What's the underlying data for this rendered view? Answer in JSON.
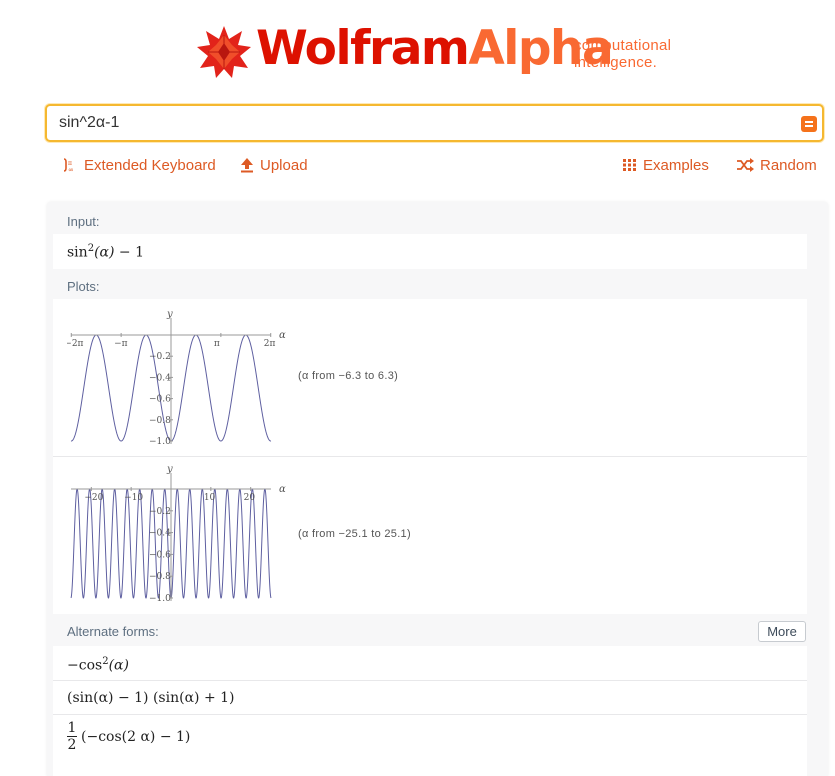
{
  "header": {
    "logo_wolfram": "Wolfram",
    "logo_alpha": "Alpha",
    "tagline_line1": "computational",
    "tagline_line2": "intelligence.",
    "logo_icon": "wolfram-star-icon"
  },
  "search": {
    "value": "sin^2α-1",
    "submit_icon": "equals-icon"
  },
  "toolbar": {
    "extended_keyboard": "Extended Keyboard",
    "upload": "Upload",
    "examples": "Examples",
    "random": "Random"
  },
  "pods": {
    "input": {
      "title": "Input:",
      "fn": "sin",
      "exp": "2",
      "arg": "(α)",
      "rest": " − 1"
    },
    "plots": {
      "title": "Plots:",
      "plot1": {
        "y_label": "y",
        "x_label": "α",
        "x_ticks": [
          "−2π",
          "−π",
          "π",
          "2π"
        ],
        "y_ticks": [
          "−0.2",
          "−0.4",
          "−0.6",
          "−0.8",
          "−1.0"
        ],
        "range_note": "(α from −6.3 to 6.3)"
      },
      "plot2": {
        "y_label": "y",
        "x_label": "α",
        "x_ticks": [
          "−20",
          "−10",
          "10",
          "20"
        ],
        "y_ticks": [
          "−0.2",
          "−0.4",
          "−0.6",
          "−0.8",
          "−1.0"
        ],
        "range_note": "(α from −25.1 to 25.1)"
      }
    },
    "alternate": {
      "title": "Alternate forms:",
      "more": "More",
      "form1_sign": "−",
      "form1_fn": "cos",
      "form1_exp": "2",
      "form1_arg": "(α)",
      "form2": "(sin(α) − 1) (sin(α) + 1)",
      "form3_num": "1",
      "form3_den": "2",
      "form3_expr": "(−cos(2 α) − 1)"
    }
  },
  "colors": {
    "brand_red": "#dd1100",
    "brand_orange": "#f96932",
    "link_orange": "#dd5a24",
    "search_border": "#f5b830",
    "curve": "#5e5fa0"
  }
}
